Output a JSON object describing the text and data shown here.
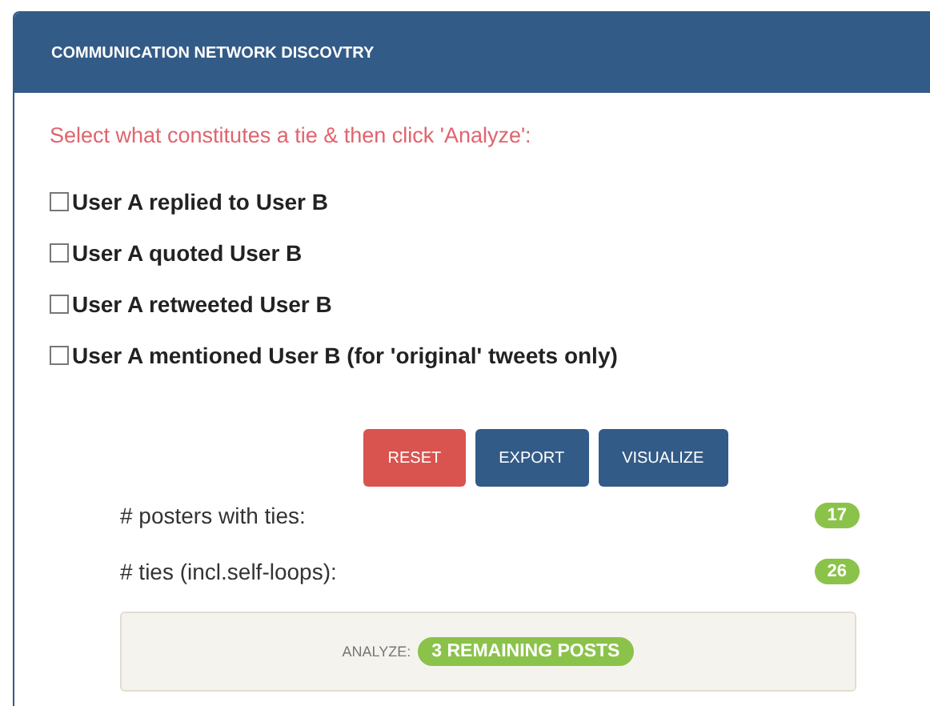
{
  "panel": {
    "title": "COMMUNICATION NETWORK DISCOVTRY"
  },
  "instruction": "Select what constitutes a tie & then click 'Analyze':",
  "ties": [
    {
      "label": "User A replied to User B",
      "checked": false
    },
    {
      "label": "User A quoted User B",
      "checked": false
    },
    {
      "label": "User A retweeted User B",
      "checked": false
    },
    {
      "label": "User A mentioned User B (for 'original' tweets only)",
      "checked": false
    }
  ],
  "buttons": [
    {
      "label": "RESET",
      "kind": "danger"
    },
    {
      "label": "EXPORT",
      "kind": "primary"
    },
    {
      "label": "VISUALIZE",
      "kind": "primary"
    }
  ],
  "stats": [
    {
      "label": "# posters with ties:",
      "value": "17"
    },
    {
      "label": "# ties (incl.self-loops):",
      "value": "26"
    }
  ],
  "analyze": {
    "label": "ANALYZE:",
    "badge": "3 REMAINING POSTS"
  }
}
